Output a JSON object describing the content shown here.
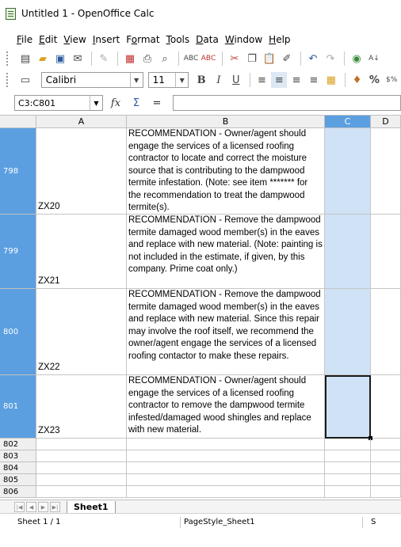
{
  "window": {
    "title": "Untitled 1 - OpenOffice Calc"
  },
  "menubar": {
    "items": [
      "File",
      "Edit",
      "View",
      "Insert",
      "Format",
      "Tools",
      "Data",
      "Window",
      "Help"
    ],
    "underlined": [
      "F",
      "E",
      "V",
      "I",
      "o",
      "T",
      "D",
      "W",
      "H"
    ]
  },
  "toolbar_icons": [
    "new-document",
    "open",
    "save",
    "email",
    "edit-file",
    "export-pdf",
    "print",
    "page-preview",
    "spellcheck",
    "autospellcheck",
    "cut",
    "copy",
    "paste",
    "clone-formatting",
    "undo",
    "redo",
    "navigator",
    "sort-ascending"
  ],
  "format_toolbar": {
    "font_name": "Calibri",
    "font_size": "11",
    "bold": "B",
    "italic": "I",
    "underline": "U",
    "percent": "%",
    "currency": "$%"
  },
  "formula_bar": {
    "name_box": "C3:C801",
    "function_wizard": "fx",
    "sum": "Σ",
    "equals": "=",
    "content": ""
  },
  "columns": [
    "A",
    "B",
    "C",
    "D"
  ],
  "selected_column": "C",
  "rows": [
    {
      "num": "798",
      "a": "ZX20",
      "b": "RECOMMENDATION - Owner/agent should engage the services of a licensed roofing contractor to locate and correct the moisture source that is contributing to the dampwood termite infestation. (Note: see item ******* for the recommendation to treat the dampwood termite(s).",
      "selected": true
    },
    {
      "num": "799",
      "a": "ZX21",
      "b": "RECOMMENDATION - Remove the dampwood termite damaged wood member(s) in the eaves and replace with new material. (Note: painting is not included in the estimate, if given, by this company. Prime coat only.)",
      "selected": true
    },
    {
      "num": "800",
      "a": "ZX22",
      "b": "RECOMMENDATION - Remove the dampwood termite damaged wood member(s) in the eaves and replace with new material. Since this repair may involve the roof itself, we recommend the owner/agent engage the services of a licensed roofing contactor to make these repairs.",
      "selected": true
    },
    {
      "num": "801",
      "a": "ZX23",
      "b": "RECOMMENDATION - Owner/agent should engage the services of a licensed roofing contractor to remove the dampwood termite infested/damaged wood shingles and replace with new material.",
      "selected": true
    },
    {
      "num": "802",
      "a": "",
      "b": "",
      "selected": false
    },
    {
      "num": "803",
      "a": "",
      "b": "",
      "selected": false
    },
    {
      "num": "804",
      "a": "",
      "b": "",
      "selected": false
    },
    {
      "num": "805",
      "a": "",
      "b": "",
      "selected": false
    },
    {
      "num": "806",
      "a": "",
      "b": "",
      "selected": false
    }
  ],
  "sheet_tabs": [
    "Sheet1"
  ],
  "statusbar": {
    "sheet": "Sheet 1 / 1",
    "page_style": "PageStyle_Sheet1",
    "edge": "S"
  },
  "colors": {
    "selection_header": "#5b9fe0",
    "selection_fill": "#cfe2f6"
  }
}
